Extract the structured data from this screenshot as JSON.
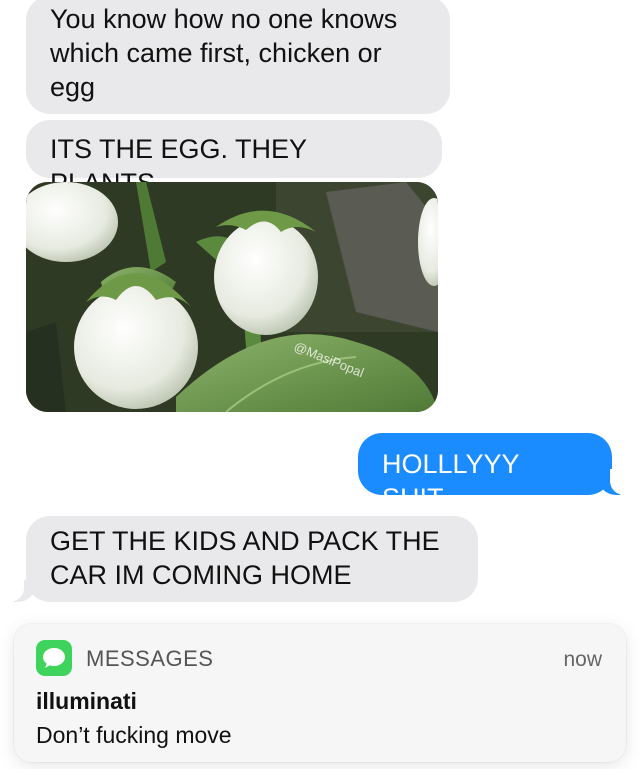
{
  "messages": [
    {
      "from": "them",
      "text_line1": "You know how no one knows",
      "text_line2": "which came first, chicken or",
      "text_line3": "egg"
    },
    {
      "from": "them",
      "text": "ITS THE EGG. THEY PLANTS"
    },
    {
      "from": "them",
      "image": "white-eggplant-photo",
      "watermark": "@MasiPopal"
    },
    {
      "from": "me",
      "text": "HOLLLYYY SHIT"
    },
    {
      "from": "them",
      "text_line1": "GET THE KIDS AND PACK THE",
      "text_line2": "CAR IM COMING HOME"
    }
  ],
  "notification": {
    "app_name": "MESSAGES",
    "time": "now",
    "sender": "illuminati",
    "body": "Don’t fucking move",
    "icon": "messages-app-icon"
  },
  "colors": {
    "incoming_bubble": "#e9e9eb",
    "outgoing_bubble": "#1b8cff",
    "messages_icon": "#3ed35c"
  }
}
